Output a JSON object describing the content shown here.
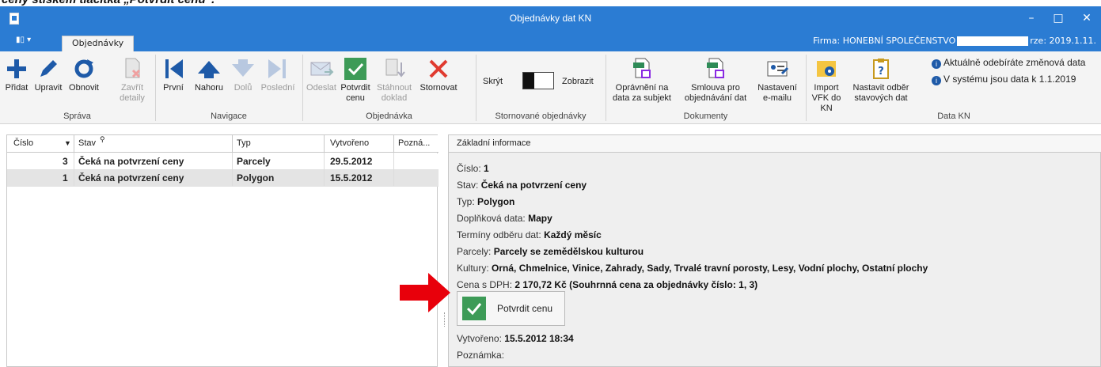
{
  "caption_fragment": "cený stiskem tlačítka „Potvrdit cenu“.",
  "window": {
    "title": "Objednávky dat KN",
    "minimize": "–",
    "maximize": "□",
    "close": "✕"
  },
  "menu": {
    "app_button": "▮▯ ▾",
    "tab": "Objednávky",
    "firma_label": "Firma:",
    "firma_value": "HONEBNÍ SPOLEČENSTVO",
    "version": "rze:  2019.1.11."
  },
  "ribbon": {
    "sprava": {
      "label": "Správa",
      "pridat": "Přidat",
      "upravit": "Upravit",
      "obnovit": "Obnovit",
      "zavrit_1": "Zavřít",
      "zavrit_2": "detaily"
    },
    "navigace": {
      "label": "Navigace",
      "prvni": "První",
      "nahoru": "Nahoru",
      "dolu": "Dolů",
      "posledni": "Poslední"
    },
    "objednavka": {
      "label": "Objednávka",
      "odeslat": "Odeslat",
      "potvrdit_1": "Potvrdit",
      "potvrdit_2": "cenu",
      "stahnout_1": "Stáhnout",
      "stahnout_2": "doklad",
      "stornovat": "Stornovat"
    },
    "stornovane": {
      "label": "Stornované objednávky",
      "skryt": "Skrýt",
      "zobrazit": "Zobrazit"
    },
    "dokumenty": {
      "label": "Dokumenty",
      "opravneni_1": "Oprávnění na",
      "opravneni_2": "data za subjekt",
      "smlouva_1": "Smlouva pro",
      "smlouva_2": "objednávání dat",
      "nastaveni_1": "Nastavení",
      "nastaveni_2": "e-mailu"
    },
    "datakn": {
      "label": "Data KN",
      "import_1": "Import",
      "import_2": "VFK do KN",
      "odber_1": "Nastavit odběr",
      "odber_2": "stavových dat",
      "info1": "Aktuálně odebíráte změnová data",
      "info2": "V systému jsou data k 1.1.2019"
    }
  },
  "grid": {
    "headers": {
      "cislo": "Číslo",
      "stav": "Stav",
      "typ": "Typ",
      "vytvoreno": "Vytvořeno",
      "pozn": "Pozná..."
    },
    "rows": [
      {
        "cislo": "3",
        "stav": "Čeká na potvrzení ceny",
        "typ": "Parcely",
        "vytvoreno": "29.5.2012"
      },
      {
        "cislo": "1",
        "stav": "Čeká na potvrzení ceny",
        "typ": "Polygon",
        "vytvoreno": "15.5.2012"
      }
    ]
  },
  "detail": {
    "header": "Základní informace",
    "cislo_l": "Číslo:",
    "cislo_v": "1",
    "stav_l": "Stav:",
    "stav_v": "Čeká na potvrzení ceny",
    "typ_l": "Typ:",
    "typ_v": "Polygon",
    "dopl_l": "Doplňková data:",
    "dopl_v": "Mapy",
    "term_l": "Termíny odběru dat:",
    "term_v": "Každý měsíc",
    "parc_l": "Parcely:",
    "parc_v": "Parcely se zemědělskou kulturou",
    "kult_l": "Kultury:",
    "kult_v": "Orná, Chmelnice, Vinice, Zahrady, Sady, Trvalé travní porosty, Lesy, Vodní plochy, Ostatní plochy",
    "cena_l": "Cena s DPH:",
    "cena_v": "2 170,72 Kč (Souhrnná cena za objednávky číslo: 1, 3)",
    "confirm_btn": "Potvrdit cenu",
    "vytv_l": "Vytvořeno:",
    "vytv_v": "15.5.2012 18:34",
    "pozn_l": "Poznámka:"
  },
  "colors": {
    "titlebar": "#2b7cd3",
    "confirm_green": "#3d9b57",
    "arrow_red": "#e8000b"
  }
}
